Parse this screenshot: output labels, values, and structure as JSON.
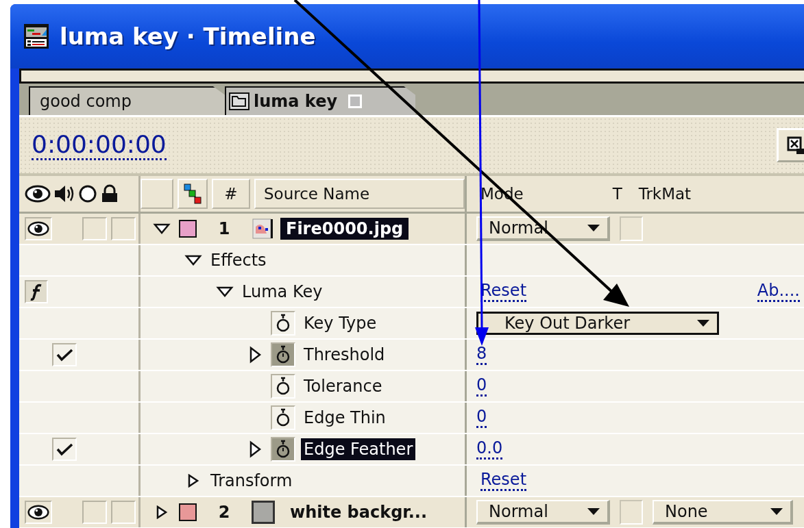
{
  "window": {
    "title": "luma key · Timeline"
  },
  "tabs": [
    {
      "label": "good comp",
      "selected": false
    },
    {
      "label": "luma key",
      "selected": true
    }
  ],
  "timecode": "0:00:00:00",
  "columns": {
    "number": "#",
    "source_name": "Source Name",
    "mode": "Mode",
    "t": "T",
    "trkmat": "TrkMat"
  },
  "layers": [
    {
      "kind": "layer",
      "number": "1",
      "name": "Fire0000.jpg",
      "source": {
        "kind": "image"
      },
      "color": "#e8a0c8",
      "visible": true,
      "selected": true,
      "expanded": true,
      "mode": "Normal",
      "preserve_transparency": false,
      "children": [
        {
          "kind": "group",
          "name": "Effects",
          "expanded": true,
          "children": [
            {
              "kind": "effect",
              "name": "Luma Key",
              "expanded": true,
              "enabled": true,
              "reset": "Reset",
              "about": "Ab....",
              "children": [
                {
                  "kind": "dropdown",
                  "name": "Key Type",
                  "value": "Key Out Darker",
                  "animated": false,
                  "selected": false
                },
                {
                  "kind": "number",
                  "name": "Threshold",
                  "value": "8",
                  "animated": true,
                  "selected": false
                },
                {
                  "kind": "number",
                  "name": "Tolerance",
                  "value": "0",
                  "animated": false,
                  "selected": false
                },
                {
                  "kind": "number",
                  "name": "Edge Thin",
                  "value": "0",
                  "animated": false,
                  "selected": false
                },
                {
                  "kind": "number",
                  "name": "Edge Feather",
                  "value": "0.0",
                  "animated": true,
                  "selected": true
                }
              ]
            }
          ]
        },
        {
          "kind": "group",
          "name": "Transform",
          "expanded": false,
          "reset": "Reset"
        }
      ]
    },
    {
      "kind": "layer",
      "number": "2",
      "name": "white backgr...",
      "source": {
        "kind": "solid"
      },
      "color": "#e89898",
      "visible": true,
      "selected": false,
      "expanded": false,
      "mode": "Normal",
      "preserve_transparency": false,
      "trkmat": "None"
    }
  ]
}
